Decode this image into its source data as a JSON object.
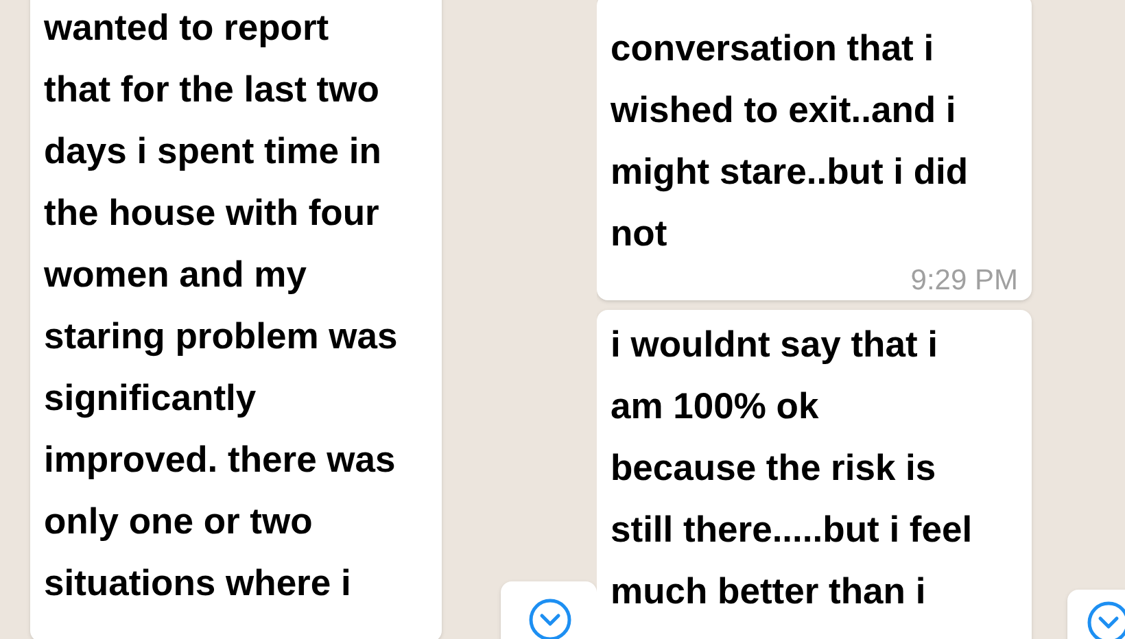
{
  "chats": [
    {
      "messages": [
        {
          "text": "wanted to report\nthat for the last two\ndays i spent time in\nthe house with four\nwomen and my\nstaring problem was\nsignificantly\nimproved. there was\nonly one or two\nsituations where i"
        }
      ]
    },
    {
      "messages": [
        {
          "text": "conversation that i\nwished to exit..and i\nmight stare..but i did\nnot",
          "time": "9:29 PM"
        },
        {
          "text": "i wouldnt say that i\nam 100% ok\nbecause the risk is\nstill there.....but i feel\nmuch better than i"
        }
      ]
    }
  ]
}
